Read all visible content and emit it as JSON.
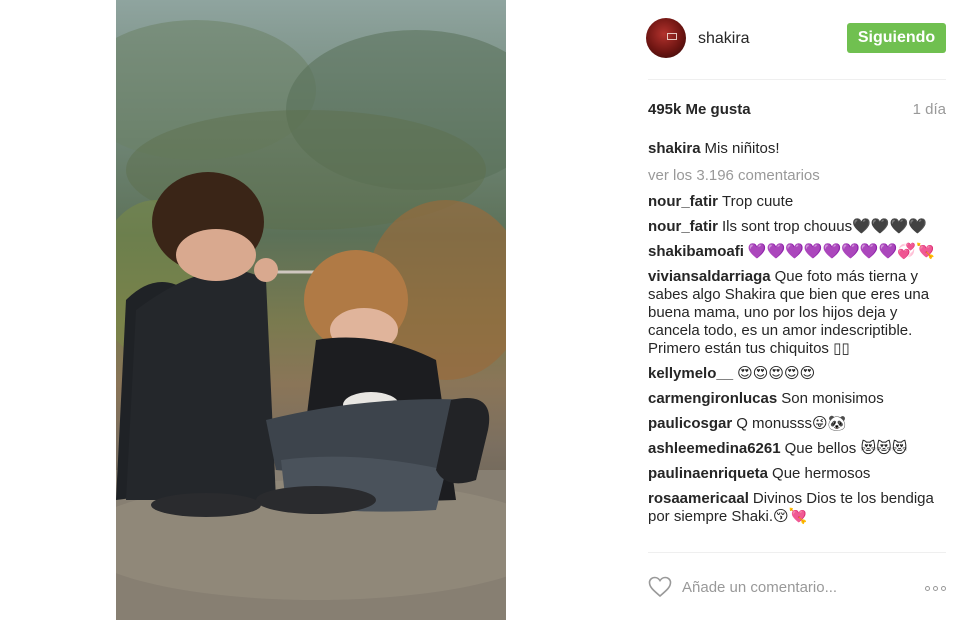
{
  "post": {
    "username": "shakira",
    "follow_label": "Siguiendo",
    "likes": "495k Me gusta",
    "time": "1 día",
    "caption_author": "shakira",
    "caption_text": "Mis niñitos!",
    "view_all": "ver los 3.196 comentarios",
    "add_comment_placeholder": "Añade un comentario..."
  },
  "comments": [
    {
      "author": "nour_fatir",
      "text": "Trop cuute"
    },
    {
      "author": "nour_fatir",
      "text": "Ils sont trop chouus🖤🖤🖤🖤"
    },
    {
      "author": "shakibamoafi",
      "text": "💜💜💜💜💜💜💜💜💞💘"
    },
    {
      "author": "viviansaldarriaga",
      "text": "Que foto más tierna y sabes algo Shakira que bien que eres una buena mama, uno por los hijos deja y cancela todo, es un amor indescriptible. Primero están tus chiquitos ▯▯"
    },
    {
      "author": "kellymelo__",
      "text": "😍😍😍😍😍"
    },
    {
      "author": "carmengironlucas",
      "text": "Son monisimos"
    },
    {
      "author": "paulicosgar",
      "text": "Q monusss😜🐼"
    },
    {
      "author": "ashleemedina6261",
      "text": "Que bellos 😻😻😻"
    },
    {
      "author": "paulinaenriqueta",
      "text": "Que hermosos"
    },
    {
      "author": "rosaamericaal",
      "text": "Divinos Dios te los bendiga por siempre Shaki.😚💘"
    }
  ],
  "colors": {
    "follow": "#70c050",
    "muted": "#999999",
    "text": "#262626"
  },
  "icons": {
    "like": "heart-outline-icon",
    "more": "more-options-icon"
  }
}
